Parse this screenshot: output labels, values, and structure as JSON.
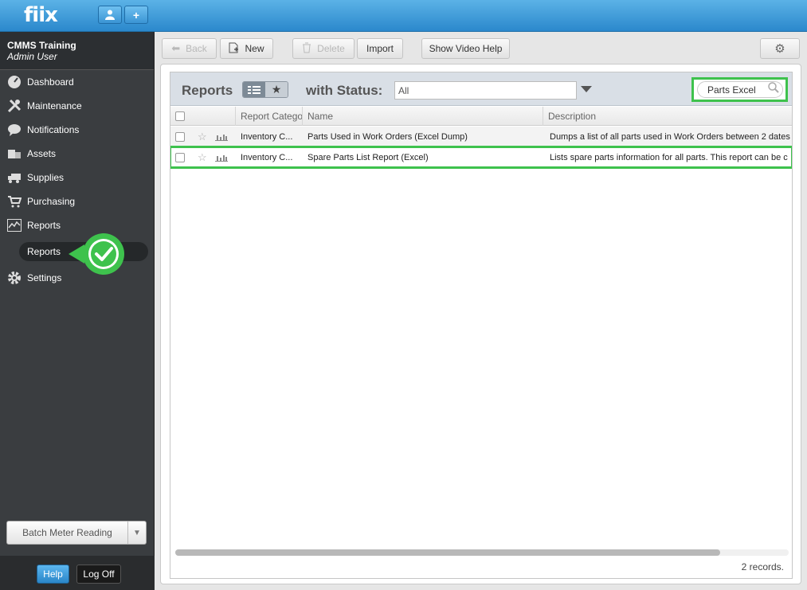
{
  "app": {
    "logo": "fiix"
  },
  "topbar": {
    "user_icon": "person-icon",
    "add_label": "+"
  },
  "account": {
    "company": "CMMS Training",
    "user": "Admin User"
  },
  "nav": {
    "items": [
      {
        "label": "Dashboard",
        "icon": "dashboard-icon"
      },
      {
        "label": "Maintenance",
        "icon": "tools-icon"
      },
      {
        "label": "Notifications",
        "icon": "speech-bubble-icon"
      },
      {
        "label": "Assets",
        "icon": "boxes-icon"
      },
      {
        "label": "Supplies",
        "icon": "truck-icon"
      },
      {
        "label": "Purchasing",
        "icon": "cart-icon"
      },
      {
        "label": "Reports",
        "icon": "chart-icon"
      },
      {
        "label": "Settings",
        "icon": "gear-icon"
      }
    ],
    "sub_item": "Reports"
  },
  "batch": {
    "label": "Batch Meter Reading"
  },
  "bottom": {
    "help": "Help",
    "logoff": "Log Off"
  },
  "toolbar": {
    "back": "Back",
    "new": "New",
    "delete": "Delete",
    "import": "Import",
    "video_help": "Show Video Help"
  },
  "grid": {
    "title": "Reports",
    "with_status": "with Status:",
    "status_value": "All",
    "search_value": "Parts Excel",
    "columns": [
      "Report Catego",
      "Name",
      "Description"
    ],
    "rows": [
      {
        "category": "Inventory C...",
        "name": "Parts Used in Work Orders (Excel Dump)",
        "description": "Dumps a list of all parts used in Work Orders between 2 dates"
      },
      {
        "category": "Inventory C...",
        "name": "Spare Parts List Report (Excel)",
        "description": "Lists spare parts information for all parts. This report can be c"
      }
    ],
    "records": "2 records."
  },
  "colors": {
    "accent": "#2b88cc",
    "highlight": "#3ec24d",
    "sidebar": "#3a3d40"
  }
}
